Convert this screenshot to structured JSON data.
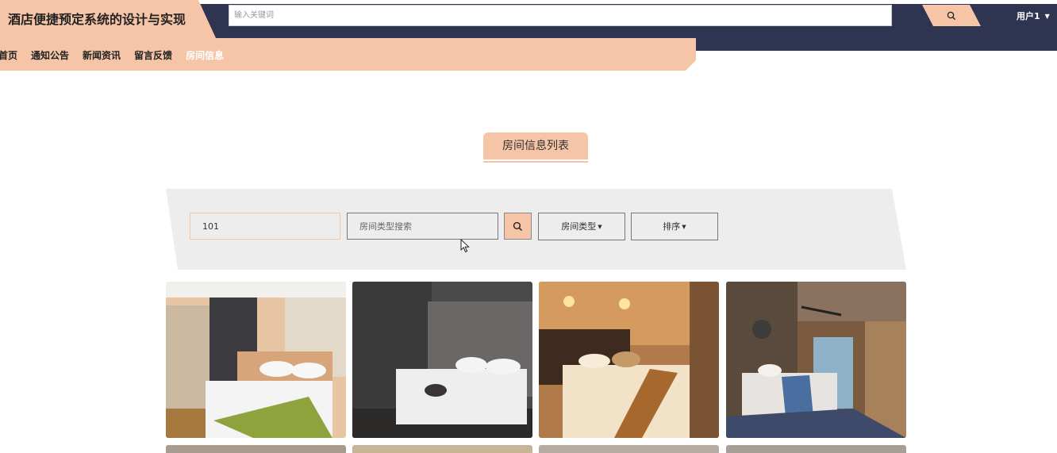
{
  "header": {
    "title": "酒店便捷预定系统的设计与实现",
    "search_placeholder": "输入关键词",
    "search_icon": "search-icon",
    "user_label": "用户1",
    "user_caret_icon": "caret-down-icon"
  },
  "nav": {
    "items": [
      {
        "label": "首页",
        "active": false
      },
      {
        "label": "通知公告",
        "active": false
      },
      {
        "label": "新闻资讯",
        "active": false
      },
      {
        "label": "留言反馈",
        "active": false
      },
      {
        "label": "房间信息",
        "active": true
      }
    ]
  },
  "section": {
    "title": "房间信息列表"
  },
  "filters": {
    "room_number_value": "101",
    "room_type_placeholder": "房间类型搜索",
    "search_icon": "search-icon",
    "room_type_dropdown": "房间类型",
    "sort_dropdown": "排序"
  },
  "rooms": [
    {
      "image": "room-photo-1"
    },
    {
      "image": "room-photo-2"
    },
    {
      "image": "room-photo-3"
    },
    {
      "image": "room-photo-4"
    }
  ],
  "colors": {
    "accent": "#f6c4a6",
    "header_bg": "#2f3450",
    "panel_bg": "#ededed"
  }
}
